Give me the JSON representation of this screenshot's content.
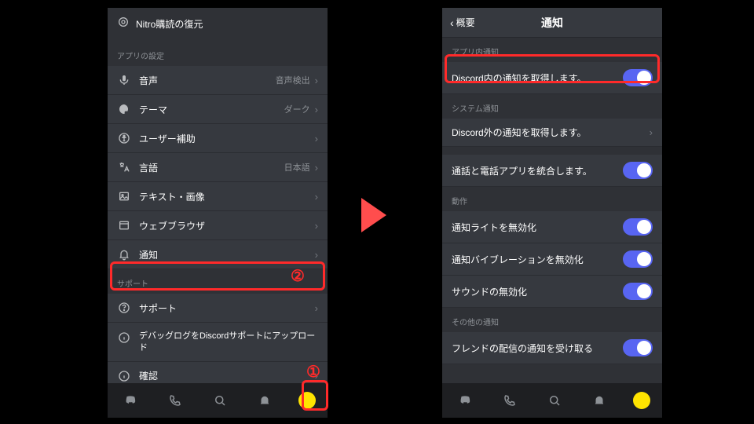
{
  "left": {
    "nitro": "Nitro購読の復元",
    "section_app": "アプリの設定",
    "rows_app": [
      {
        "icon": "mic",
        "label": "音声",
        "value": "音声検出"
      },
      {
        "icon": "palette",
        "label": "テーマ",
        "value": "ダーク"
      },
      {
        "icon": "accessibility",
        "label": "ユーザー補助",
        "value": ""
      },
      {
        "icon": "translate",
        "label": "言語",
        "value": "日本語"
      },
      {
        "icon": "image",
        "label": "テキスト・画像",
        "value": ""
      },
      {
        "icon": "browser",
        "label": "ウェブブラウザ",
        "value": ""
      },
      {
        "icon": "bell",
        "label": "通知",
        "value": ""
      }
    ],
    "section_support": "サポート",
    "rows_support": [
      {
        "icon": "help",
        "label": "サポート"
      },
      {
        "icon": "info",
        "label": "デバッグログをDiscordサポートにアップロード"
      },
      {
        "icon": "info",
        "label": "確認"
      }
    ]
  },
  "right": {
    "back": "概要",
    "title": "通知",
    "s1": "アプリ内通知",
    "r1": "Discord内の通知を取得します。",
    "s2": "システム通知",
    "r2a": "Discord外の通知を取得します。",
    "r2b": "通話と電話アプリを統合します。",
    "s3": "動作",
    "r3a": "通知ライトを無効化",
    "r3b": "通知バイブレーションを無効化",
    "r3c": "サウンドの無効化",
    "s4": "その他の通知",
    "r4a": "フレンドの配信の通知を受け取る"
  },
  "annotations": {
    "badge1": "①",
    "badge2": "②"
  }
}
